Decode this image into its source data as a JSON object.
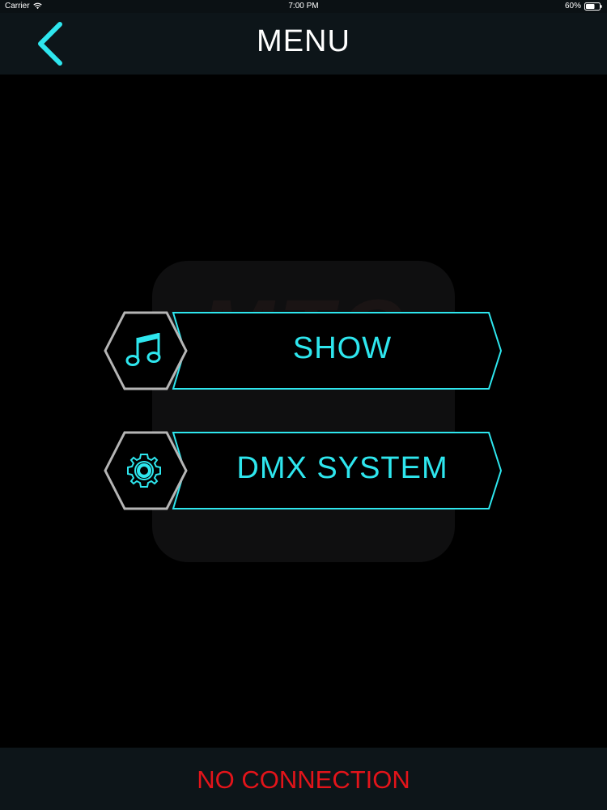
{
  "status_bar": {
    "carrier": "Carrier",
    "time": "7:00 PM",
    "battery": "60%"
  },
  "header": {
    "title": "MENU",
    "back_icon": "chevron-left-icon"
  },
  "watermark": {
    "text": "MTC"
  },
  "menu": {
    "items": [
      {
        "label": "SHOW",
        "icon": "music-note-icon"
      },
      {
        "label": "DMX SYSTEM",
        "icon": "gear-icon"
      }
    ]
  },
  "footer": {
    "connection_status": "NO CONNECTION"
  },
  "colors": {
    "accent": "#2ee6ee",
    "error": "#e3141a",
    "bar_background": "#0d1519",
    "hexagon_border": "#b5b5b5"
  }
}
